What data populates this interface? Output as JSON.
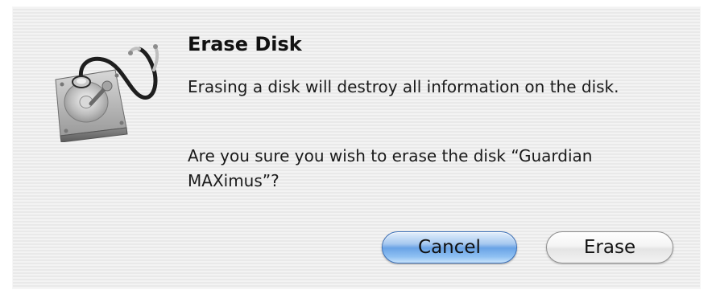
{
  "dialog": {
    "icon": "disk-utility-icon",
    "title": "Erase Disk",
    "message": "Erasing a disk will destroy all information on the disk.",
    "question": "Are you sure you wish to erase the disk “Guardian MAXimus”?",
    "buttons": {
      "cancel_label": "Cancel",
      "erase_label": "Erase"
    }
  },
  "colors": {
    "default_button": "#6aa3e6",
    "dialog_background": "#eeeeee"
  }
}
